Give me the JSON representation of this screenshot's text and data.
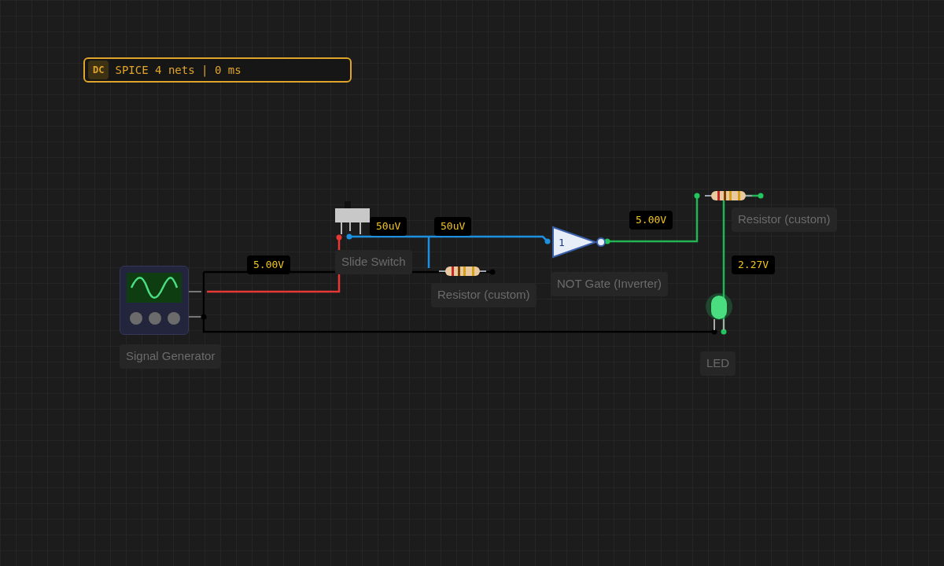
{
  "status": {
    "mode": "DC",
    "text": "SPICE 4 nets | 0 ms"
  },
  "components": [
    {
      "kind": "signal_generator",
      "label": "Signal Generator"
    },
    {
      "kind": "switch",
      "label": "Slide Switch"
    },
    {
      "kind": "resistor",
      "label": "Resistor (custom)"
    },
    {
      "kind": "not_gate",
      "label": "NOT Gate (Inverter)",
      "symbol": "1"
    },
    {
      "kind": "resistor",
      "label": "Resistor (custom)"
    },
    {
      "kind": "led",
      "label": "LED",
      "on": true
    }
  ],
  "probes": [
    {
      "reading": "5.00V"
    },
    {
      "reading": "50uV"
    },
    {
      "reading": "50uV"
    },
    {
      "reading": "5.00V"
    },
    {
      "reading": "2.27V"
    }
  ]
}
